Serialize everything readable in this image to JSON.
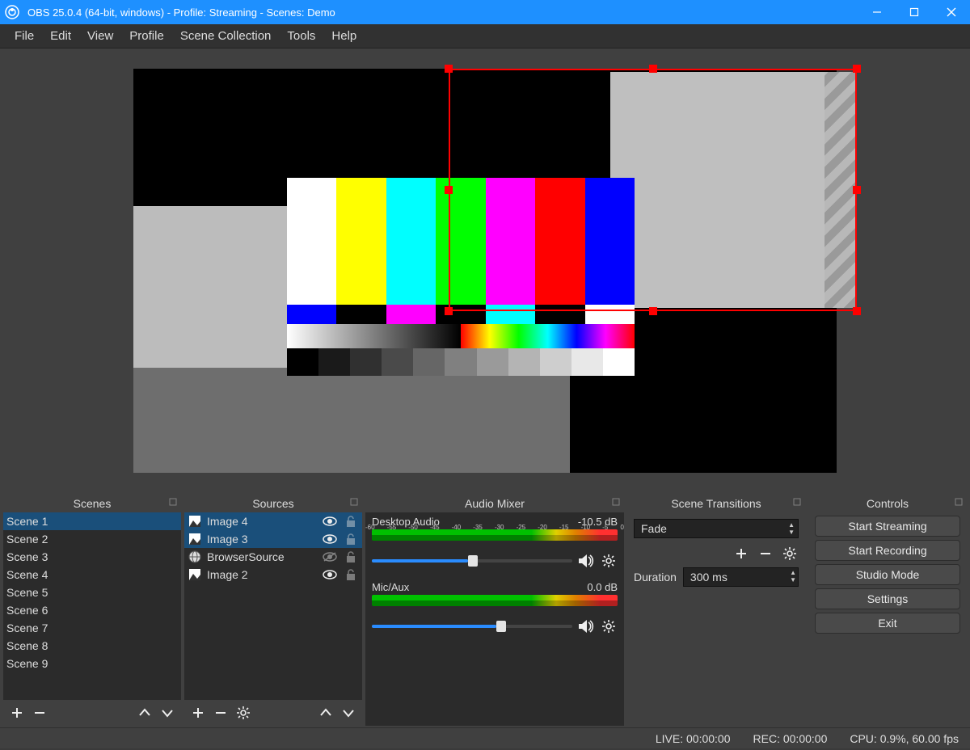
{
  "titlebar": {
    "title": "OBS 25.0.4 (64-bit, windows) - Profile: Streaming - Scenes: Demo"
  },
  "menu": [
    "File",
    "Edit",
    "View",
    "Profile",
    "Scene Collection",
    "Tools",
    "Help"
  ],
  "panels": {
    "scenes": {
      "title": "Scenes"
    },
    "sources": {
      "title": "Sources"
    },
    "mixer": {
      "title": "Audio Mixer"
    },
    "transitions": {
      "title": "Scene Transitions"
    },
    "controls": {
      "title": "Controls"
    }
  },
  "scenes": [
    "Scene 1",
    "Scene 2",
    "Scene 3",
    "Scene 4",
    "Scene 5",
    "Scene 6",
    "Scene 7",
    "Scene 8",
    "Scene 9"
  ],
  "scenes_selected": 0,
  "sources": [
    {
      "name": "Image 4",
      "type": "image",
      "visible": true,
      "locked": false,
      "selected": true
    },
    {
      "name": "Image 3",
      "type": "image",
      "visible": true,
      "locked": false,
      "selected": true
    },
    {
      "name": "BrowserSource",
      "type": "browser",
      "visible": false,
      "locked": false,
      "selected": false
    },
    {
      "name": "Image 2",
      "type": "image",
      "visible": true,
      "locked": false,
      "selected": false
    }
  ],
  "mixer": {
    "ticks": [
      "-60",
      "-55",
      "-50",
      "-45",
      "-40",
      "-35",
      "-30",
      "-25",
      "-20",
      "-15",
      "-10",
      "-5",
      "0"
    ],
    "tracks": [
      {
        "name": "Desktop Audio",
        "db": "-10.5 dB",
        "slider_pct": 48
      },
      {
        "name": "Mic/Aux",
        "db": "0.0 dB",
        "slider_pct": 62
      }
    ]
  },
  "transitions": {
    "selected": "Fade",
    "duration_label": "Duration",
    "duration_value": "300 ms"
  },
  "controls": [
    "Start Streaming",
    "Start Recording",
    "Studio Mode",
    "Settings",
    "Exit"
  ],
  "statusbar": {
    "live": "LIVE: 00:00:00",
    "rec": "REC: 00:00:00",
    "cpu": "CPU: 0.9%, 60.00 fps"
  }
}
